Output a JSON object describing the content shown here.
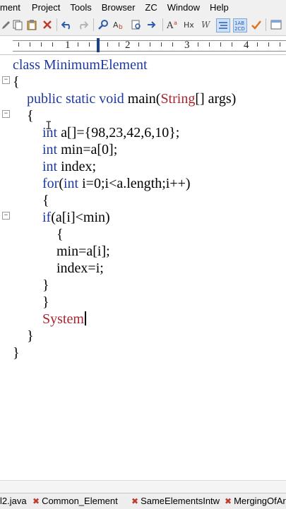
{
  "menu": {
    "items": [
      "ment",
      "Project",
      "Tools",
      "Browser",
      "ZC",
      "Window",
      "Help"
    ]
  },
  "ruler": {
    "labels": [
      "1",
      "2",
      "3",
      "4"
    ]
  },
  "code": {
    "lines": [
      "class MinimumElement",
      "{",
      "public static void main(String[] args)",
      "{",
      "int a[]={98,23,42,6,10};",
      "int min=a[0];",
      "int index;",
      "for(int i=0;i<a.length;i++)",
      "{",
      "if(a[i]<min)",
      "{",
      "min=a[i];",
      "index=i;",
      "}",
      "}",
      "System",
      "}",
      "}"
    ]
  },
  "tabs": {
    "items": [
      "l2.java",
      "Common_Element",
      "SameElementsIntw",
      "MergingOfArr"
    ]
  },
  "colors": {
    "keyword": "#1f3a9e",
    "type": "#a8242e",
    "text": "#000000"
  }
}
